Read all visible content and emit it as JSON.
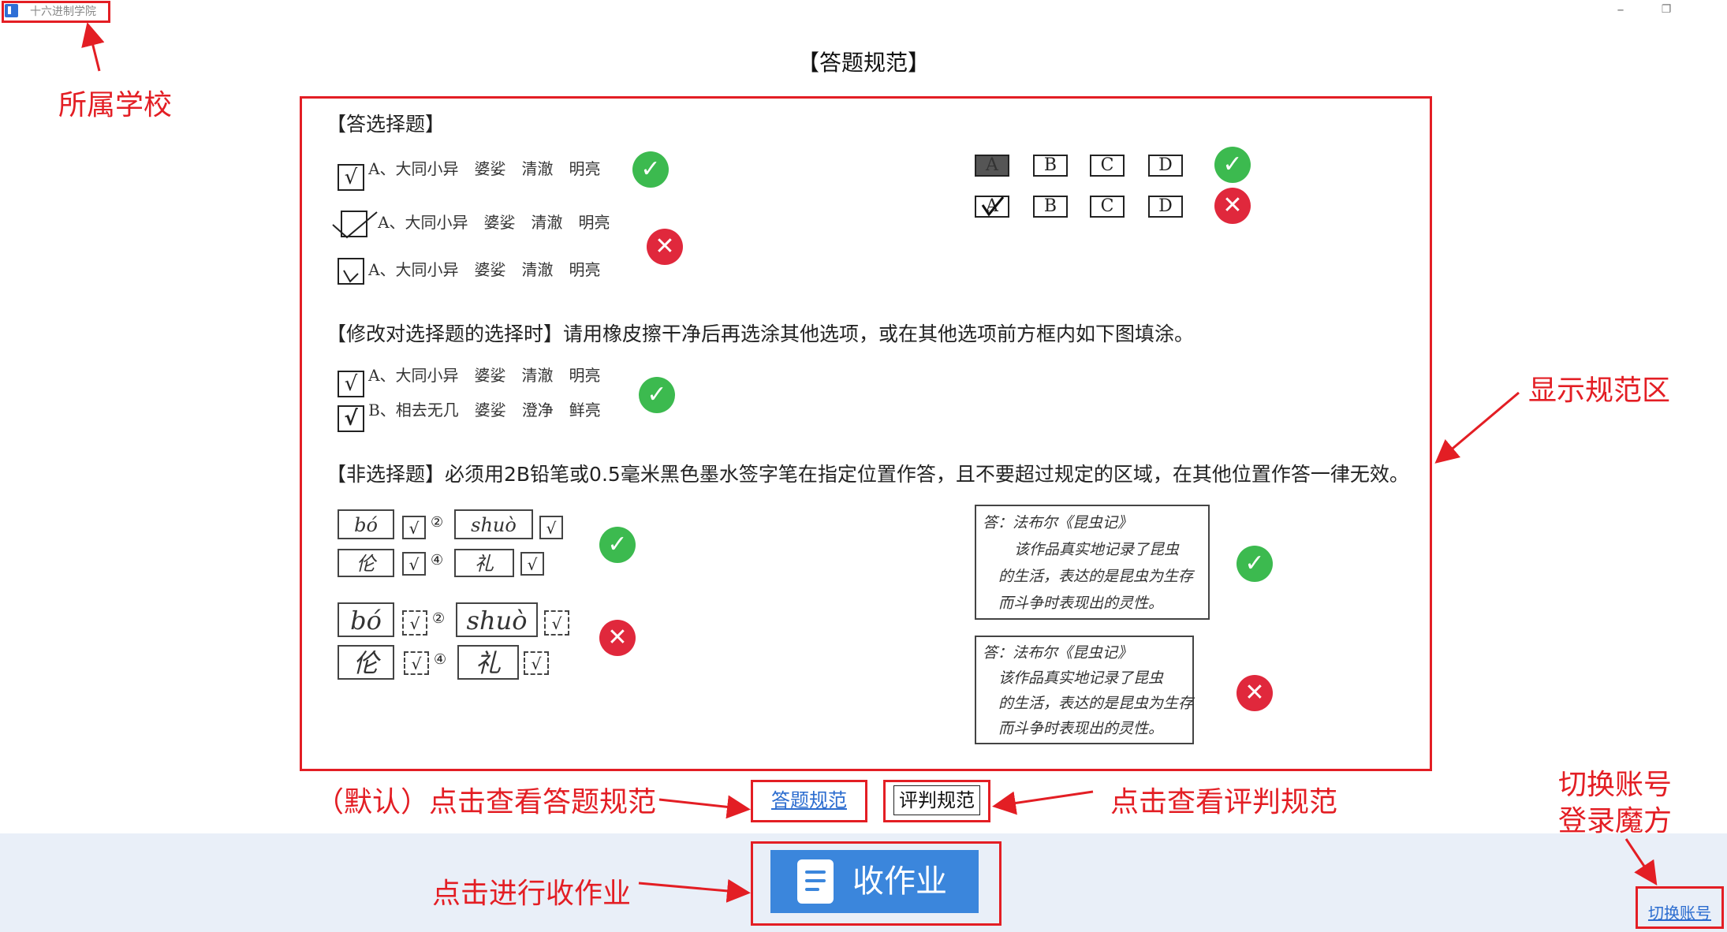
{
  "titlebar": {
    "school_name": "十六进制学院",
    "minimize_glyph": "–",
    "restore_glyph": "❐"
  },
  "page_title": "【答题规范】",
  "spec": {
    "choice_heading": "【答选择题】",
    "choice_rows": [
      {
        "mark": "√",
        "text": "A、大同小异　婆娑　清澈　明亮"
      },
      {
        "mark": "",
        "text": "A、大同小异　婆娑　清澈　明亮"
      },
      {
        "mark": "",
        "text": "A、大同小异　婆娑　清澈　明亮"
      }
    ],
    "option_letters": [
      "A",
      "B",
      "C",
      "D"
    ],
    "modify_heading": "【修改对选择题的选择时】请用橡皮擦干净后再选涂其他选项，或在其他选项前方框内如下图填涂。",
    "modify_rows": [
      {
        "mark": "√",
        "text": "A、大同小异　婆娑　清澈　明亮"
      },
      {
        "mark": "√",
        "text": "B、相去无几　婆娑　澄净　鲜亮"
      }
    ],
    "nonchoice_heading": "【非选择题】必须用2B铅笔或0.5毫米黑色墨水签字笔在指定位置作答，且不要超过规定的区域，在其他位置作答一律无效。",
    "fill_words": [
      "bó",
      "shuò",
      "伦",
      "礼"
    ],
    "circle_nums": [
      "②",
      "④"
    ],
    "check": "√",
    "essay_lines": [
      "答：法布尔《昆虫记》",
      "该作品真实地记录了昆虫",
      "的生活，表达的是昆虫为生存",
      "而斗争时表现出的灵性。"
    ],
    "ok_glyph": "✓",
    "bad_glyph": "✕"
  },
  "tabs": {
    "answer_label": "答题规范",
    "judge_label": "评判规范"
  },
  "collect_button": {
    "label": "收作业"
  },
  "switch_account": {
    "label": "切换账号"
  },
  "annotations": {
    "school": "所属学校",
    "spec_area": "显示规范区",
    "default_answer": "（默认）点击查看答题规范",
    "view_judge": "点击查看评判规范",
    "collect": "点击进行收作业",
    "switch_line1": "切换账号",
    "switch_line2": "登录魔方"
  },
  "colors": {
    "accent": "#3b86dc",
    "annotation": "#e31e24",
    "ok": "#3cba4f",
    "bad": "#e0283c"
  }
}
